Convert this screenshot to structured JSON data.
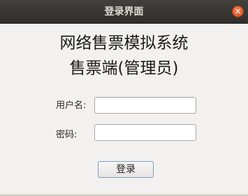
{
  "window": {
    "title": "登录界面",
    "close_icon": "×"
  },
  "heading": {
    "line1": "网络售票模拟系统",
    "line2": "售票端(管理员)"
  },
  "form": {
    "username_label": "用户名:",
    "username_value": "",
    "password_label": "密码:",
    "password_value": "",
    "login_label": "登录"
  },
  "colors": {
    "titlebar": "#3c3b37",
    "close_button": "#e05a26",
    "window_bg": "#f2f1f0",
    "button_border": "#7e9cc4"
  }
}
